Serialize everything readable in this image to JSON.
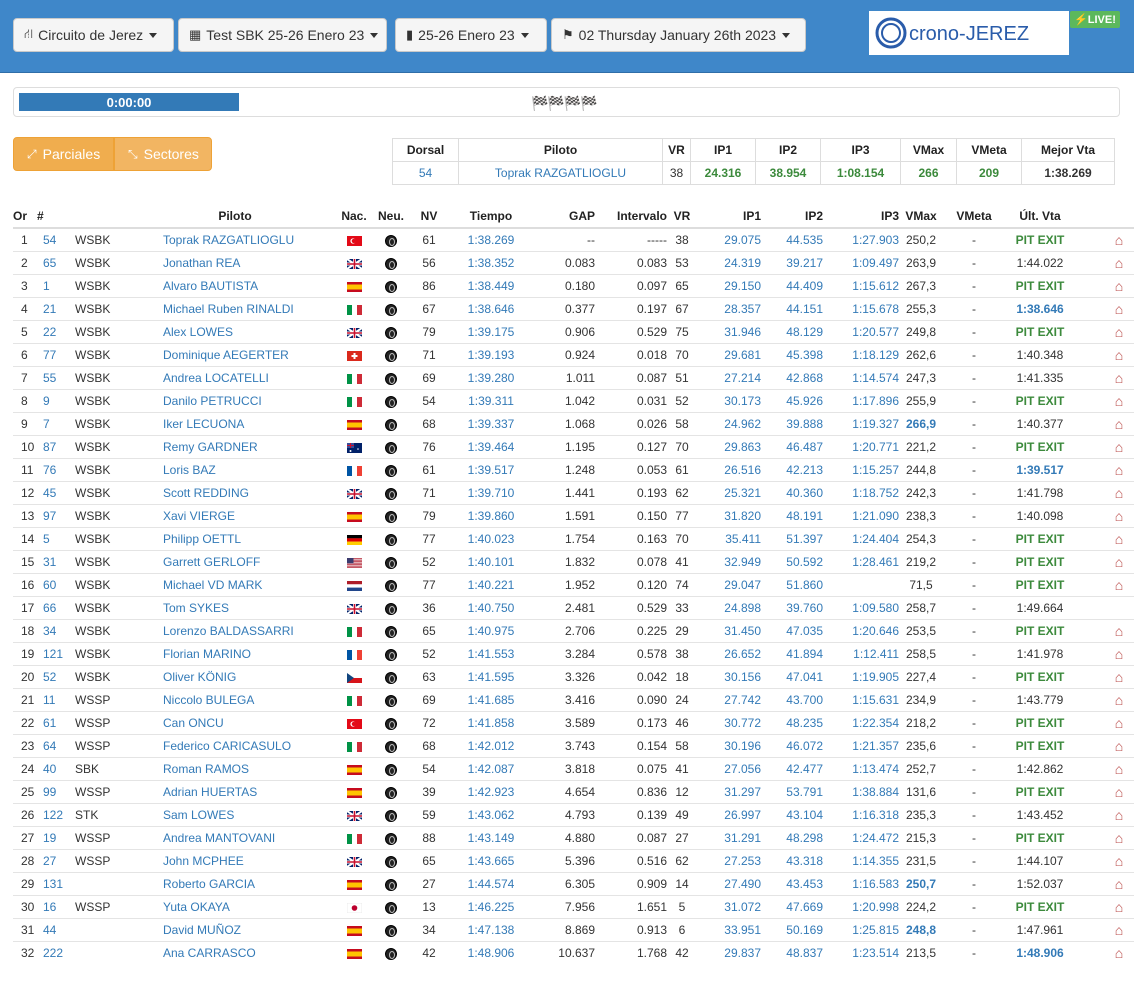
{
  "nav": {
    "circuit": "Circuito de Jerez",
    "event": "Test SBK 25-26 Enero 23",
    "dates": "25-26 Enero 23",
    "session": "02 Thursday January 26th 2023"
  },
  "logo_text": "crono-JEREZ",
  "live_label": "LIVE!",
  "timer": "0:00:00",
  "flags": "🏁🏁🏁🏁",
  "buttons": {
    "parciales": "Parciales",
    "sectores": "Sectores"
  },
  "best": {
    "headers": [
      "Dorsal",
      "Piloto",
      "VR",
      "IP1",
      "IP2",
      "IP3",
      "VMax",
      "VMeta",
      "Mejor Vta"
    ],
    "row": [
      "54",
      "Toprak RAZGATLIOGLU",
      "38",
      "24.316",
      "38.954",
      "1:08.154",
      "266",
      "209",
      "1:38.269"
    ]
  },
  "columns": [
    "Or",
    "#",
    "",
    "Piloto",
    "Nac.",
    "Neu.",
    "NV",
    "Tiempo",
    "GAP",
    "Intervalo",
    "VR",
    "IP1",
    "IP2",
    "IP3",
    "VMax",
    "VMeta",
    "Últ. Vta",
    ""
  ],
  "pit_exit_label": "PIT EXIT",
  "colors": {
    "header": "#3f87c9",
    "link": "#337ab7",
    "pit": "#3c8a3c",
    "accent": "#f0ad4e",
    "home": "#b94a48"
  },
  "rows": [
    {
      "or": "1",
      "num": "54",
      "cls": "WSBK",
      "name": "Toprak RAZGATLIOGLU",
      "nat": "tr",
      "nv": "61",
      "time": "1:38.269",
      "gap": "--",
      "int": "-----",
      "vr": "38",
      "ip1": "29.075",
      "ip2": "44.535",
      "ip3": "1:27.903",
      "vmax": "250,2",
      "vmaxb": false,
      "vmeta": "-",
      "last": "PIT EXIT",
      "lastType": "pit",
      "home": true
    },
    {
      "or": "2",
      "num": "65",
      "cls": "WSBK",
      "name": "Jonathan REA",
      "nat": "gb",
      "nv": "56",
      "time": "1:38.352",
      "gap": "0.083",
      "int": "0.083",
      "vr": "53",
      "ip1": "24.319",
      "ip2": "39.217",
      "ip3": "1:09.497",
      "vmax": "263,9",
      "vmaxb": false,
      "vmeta": "-",
      "last": "1:44.022",
      "lastType": "t",
      "home": true
    },
    {
      "or": "3",
      "num": "1",
      "cls": "WSBK",
      "name": "Alvaro BAUTISTA",
      "nat": "es",
      "nv": "86",
      "time": "1:38.449",
      "gap": "0.180",
      "int": "0.097",
      "vr": "65",
      "ip1": "29.150",
      "ip2": "44.409",
      "ip3": "1:15.612",
      "vmax": "267,3",
      "vmaxb": false,
      "vmeta": "-",
      "last": "PIT EXIT",
      "lastType": "pit",
      "home": true
    },
    {
      "or": "4",
      "num": "21",
      "cls": "WSBK",
      "name": "Michael Ruben RINALDI",
      "nat": "it",
      "nv": "67",
      "time": "1:38.646",
      "gap": "0.377",
      "int": "0.197",
      "vr": "67",
      "ip1": "28.357",
      "ip2": "44.151",
      "ip3": "1:15.678",
      "vmax": "255,3",
      "vmaxb": false,
      "vmeta": "-",
      "last": "1:38.646",
      "lastType": "best",
      "home": true
    },
    {
      "or": "5",
      "num": "22",
      "cls": "WSBK",
      "name": "Alex LOWES",
      "nat": "gb",
      "nv": "79",
      "time": "1:39.175",
      "gap": "0.906",
      "int": "0.529",
      "vr": "75",
      "ip1": "31.946",
      "ip2": "48.129",
      "ip3": "1:20.577",
      "vmax": "249,8",
      "vmaxb": false,
      "vmeta": "-",
      "last": "PIT EXIT",
      "lastType": "pit",
      "home": true
    },
    {
      "or": "6",
      "num": "77",
      "cls": "WSBK",
      "name": "Dominique AEGERTER",
      "nat": "ch",
      "nv": "71",
      "time": "1:39.193",
      "gap": "0.924",
      "int": "0.018",
      "vr": "70",
      "ip1": "29.681",
      "ip2": "45.398",
      "ip3": "1:18.129",
      "vmax": "262,6",
      "vmaxb": false,
      "vmeta": "-",
      "last": "1:40.348",
      "lastType": "t",
      "home": true
    },
    {
      "or": "7",
      "num": "55",
      "cls": "WSBK",
      "name": "Andrea LOCATELLI",
      "nat": "it",
      "nv": "69",
      "time": "1:39.280",
      "gap": "1.011",
      "int": "0.087",
      "vr": "51",
      "ip1": "27.214",
      "ip2": "42.868",
      "ip3": "1:14.574",
      "vmax": "247,3",
      "vmaxb": false,
      "vmeta": "-",
      "last": "1:41.335",
      "lastType": "t",
      "home": true
    },
    {
      "or": "8",
      "num": "9",
      "cls": "WSBK",
      "name": "Danilo PETRUCCI",
      "nat": "it",
      "nv": "54",
      "time": "1:39.311",
      "gap": "1.042",
      "int": "0.031",
      "vr": "52",
      "ip1": "30.173",
      "ip2": "45.926",
      "ip3": "1:17.896",
      "vmax": "255,9",
      "vmaxb": false,
      "vmeta": "-",
      "last": "PIT EXIT",
      "lastType": "pit",
      "home": true
    },
    {
      "or": "9",
      "num": "7",
      "cls": "WSBK",
      "name": "Iker LECUONA",
      "nat": "es",
      "nv": "68",
      "time": "1:39.337",
      "gap": "1.068",
      "int": "0.026",
      "vr": "58",
      "ip1": "24.962",
      "ip2": "39.888",
      "ip3": "1:19.327",
      "vmax": "266,9",
      "vmaxb": true,
      "vmeta": "-",
      "last": "1:40.377",
      "lastType": "t",
      "home": true
    },
    {
      "or": "10",
      "num": "87",
      "cls": "WSBK",
      "name": "Remy GARDNER",
      "nat": "au",
      "nv": "76",
      "time": "1:39.464",
      "gap": "1.195",
      "int": "0.127",
      "vr": "70",
      "ip1": "29.863",
      "ip2": "46.487",
      "ip3": "1:20.771",
      "vmax": "221,2",
      "vmaxb": false,
      "vmeta": "-",
      "last": "PIT EXIT",
      "lastType": "pit",
      "home": true
    },
    {
      "or": "11",
      "num": "76",
      "cls": "WSBK",
      "name": "Loris BAZ",
      "nat": "fr",
      "nv": "61",
      "time": "1:39.517",
      "gap": "1.248",
      "int": "0.053",
      "vr": "61",
      "ip1": "26.516",
      "ip2": "42.213",
      "ip3": "1:15.257",
      "vmax": "244,8",
      "vmaxb": false,
      "vmeta": "-",
      "last": "1:39.517",
      "lastType": "best",
      "home": true
    },
    {
      "or": "12",
      "num": "45",
      "cls": "WSBK",
      "name": "Scott REDDING",
      "nat": "gb",
      "nv": "71",
      "time": "1:39.710",
      "gap": "1.441",
      "int": "0.193",
      "vr": "62",
      "ip1": "25.321",
      "ip2": "40.360",
      "ip3": "1:18.752",
      "vmax": "242,3",
      "vmaxb": false,
      "vmeta": "-",
      "last": "1:41.798",
      "lastType": "t",
      "home": true
    },
    {
      "or": "13",
      "num": "97",
      "cls": "WSBK",
      "name": "Xavi VIERGE",
      "nat": "es",
      "nv": "79",
      "time": "1:39.860",
      "gap": "1.591",
      "int": "0.150",
      "vr": "77",
      "ip1": "31.820",
      "ip2": "48.191",
      "ip3": "1:21.090",
      "vmax": "238,3",
      "vmaxb": false,
      "vmeta": "-",
      "last": "1:40.098",
      "lastType": "t",
      "home": true
    },
    {
      "or": "14",
      "num": "5",
      "cls": "WSBK",
      "name": "Philipp OETTL",
      "nat": "de",
      "nv": "77",
      "time": "1:40.023",
      "gap": "1.754",
      "int": "0.163",
      "vr": "70",
      "ip1": "35.411",
      "ip2": "51.397",
      "ip3": "1:24.404",
      "vmax": "254,3",
      "vmaxb": false,
      "vmeta": "-",
      "last": "PIT EXIT",
      "lastType": "pit",
      "home": true
    },
    {
      "or": "15",
      "num": "31",
      "cls": "WSBK",
      "name": "Garrett GERLOFF",
      "nat": "us",
      "nv": "52",
      "time": "1:40.101",
      "gap": "1.832",
      "int": "0.078",
      "vr": "41",
      "ip1": "32.949",
      "ip2": "50.592",
      "ip3": "1:28.461",
      "vmax": "219,2",
      "vmaxb": false,
      "vmeta": "-",
      "last": "PIT EXIT",
      "lastType": "pit",
      "home": true
    },
    {
      "or": "16",
      "num": "60",
      "cls": "WSBK",
      "name": "Michael VD MARK",
      "nat": "nl",
      "nv": "77",
      "time": "1:40.221",
      "gap": "1.952",
      "int": "0.120",
      "vr": "74",
      "ip1": "29.047",
      "ip2": "51.860",
      "ip3": "",
      "vmax": "71,5",
      "vmaxb": false,
      "vmeta": "-",
      "last": "PIT EXIT",
      "lastType": "pit",
      "home": true
    },
    {
      "or": "17",
      "num": "66",
      "cls": "WSBK",
      "name": "Tom SYKES",
      "nat": "gb",
      "nv": "36",
      "time": "1:40.750",
      "gap": "2.481",
      "int": "0.529",
      "vr": "33",
      "ip1": "24.898",
      "ip2": "39.760",
      "ip3": "1:09.580",
      "vmax": "258,7",
      "vmaxb": false,
      "vmeta": "-",
      "last": "1:49.664",
      "lastType": "t",
      "home": false
    },
    {
      "or": "18",
      "num": "34",
      "cls": "WSBK",
      "name": "Lorenzo BALDASSARRI",
      "nat": "it",
      "nv": "65",
      "time": "1:40.975",
      "gap": "2.706",
      "int": "0.225",
      "vr": "29",
      "ip1": "31.450",
      "ip2": "47.035",
      "ip3": "1:20.646",
      "vmax": "253,5",
      "vmaxb": false,
      "vmeta": "-",
      "last": "PIT EXIT",
      "lastType": "pit",
      "home": true
    },
    {
      "or": "19",
      "num": "121",
      "cls": "WSBK",
      "name": "Florian MARINO",
      "nat": "fr",
      "nv": "52",
      "time": "1:41.553",
      "gap": "3.284",
      "int": "0.578",
      "vr": "38",
      "ip1": "26.652",
      "ip2": "41.894",
      "ip3": "1:12.411",
      "vmax": "258,5",
      "vmaxb": false,
      "vmeta": "-",
      "last": "1:41.978",
      "lastType": "t",
      "home": true
    },
    {
      "or": "20",
      "num": "52",
      "cls": "WSBK",
      "name": "Oliver KÖNIG",
      "nat": "cz",
      "nv": "63",
      "time": "1:41.595",
      "gap": "3.326",
      "int": "0.042",
      "vr": "18",
      "ip1": "30.156",
      "ip2": "47.041",
      "ip3": "1:19.905",
      "vmax": "227,4",
      "vmaxb": false,
      "vmeta": "-",
      "last": "PIT EXIT",
      "lastType": "pit",
      "home": true
    },
    {
      "or": "21",
      "num": "11",
      "cls": "WSSP",
      "name": "Niccolo BULEGA",
      "nat": "it",
      "nv": "69",
      "time": "1:41.685",
      "gap": "3.416",
      "int": "0.090",
      "vr": "24",
      "ip1": "27.742",
      "ip2": "43.700",
      "ip3": "1:15.631",
      "vmax": "234,9",
      "vmaxb": false,
      "vmeta": "-",
      "last": "1:43.779",
      "lastType": "t",
      "home": true
    },
    {
      "or": "22",
      "num": "61",
      "cls": "WSSP",
      "name": "Can ONCU",
      "nat": "tr",
      "nv": "72",
      "time": "1:41.858",
      "gap": "3.589",
      "int": "0.173",
      "vr": "46",
      "ip1": "30.772",
      "ip2": "48.235",
      "ip3": "1:22.354",
      "vmax": "218,2",
      "vmaxb": false,
      "vmeta": "-",
      "last": "PIT EXIT",
      "lastType": "pit",
      "home": true
    },
    {
      "or": "23",
      "num": "64",
      "cls": "WSSP",
      "name": "Federico CARICASULO",
      "nat": "it",
      "nv": "68",
      "time": "1:42.012",
      "gap": "3.743",
      "int": "0.154",
      "vr": "58",
      "ip1": "30.196",
      "ip2": "46.072",
      "ip3": "1:21.357",
      "vmax": "235,6",
      "vmaxb": false,
      "vmeta": "-",
      "last": "PIT EXIT",
      "lastType": "pit",
      "home": true
    },
    {
      "or": "24",
      "num": "40",
      "cls": "SBK",
      "name": "Roman RAMOS",
      "nat": "es",
      "nv": "54",
      "time": "1:42.087",
      "gap": "3.818",
      "int": "0.075",
      "vr": "41",
      "ip1": "27.056",
      "ip2": "42.477",
      "ip3": "1:13.474",
      "vmax": "252,7",
      "vmaxb": false,
      "vmeta": "-",
      "last": "1:42.862",
      "lastType": "t",
      "home": true
    },
    {
      "or": "25",
      "num": "99",
      "cls": "WSSP",
      "name": "Adrian HUERTAS",
      "nat": "es",
      "nv": "39",
      "time": "1:42.923",
      "gap": "4.654",
      "int": "0.836",
      "vr": "12",
      "ip1": "31.297",
      "ip2": "53.791",
      "ip3": "1:38.884",
      "vmax": "131,6",
      "vmaxb": false,
      "vmeta": "-",
      "last": "PIT EXIT",
      "lastType": "pit",
      "home": true
    },
    {
      "or": "26",
      "num": "122",
      "cls": "STK",
      "name": "Sam LOWES",
      "nat": "gb",
      "nv": "59",
      "time": "1:43.062",
      "gap": "4.793",
      "int": "0.139",
      "vr": "49",
      "ip1": "26.997",
      "ip2": "43.104",
      "ip3": "1:16.318",
      "vmax": "235,3",
      "vmaxb": false,
      "vmeta": "-",
      "last": "1:43.452",
      "lastType": "t",
      "home": true
    },
    {
      "or": "27",
      "num": "19",
      "cls": "WSSP",
      "name": "Andrea MANTOVANI",
      "nat": "it",
      "nv": "88",
      "time": "1:43.149",
      "gap": "4.880",
      "int": "0.087",
      "vr": "27",
      "ip1": "31.291",
      "ip2": "48.298",
      "ip3": "1:24.472",
      "vmax": "215,3",
      "vmaxb": false,
      "vmeta": "-",
      "last": "PIT EXIT",
      "lastType": "pit",
      "home": true
    },
    {
      "or": "28",
      "num": "27",
      "cls": "WSSP",
      "name": "John MCPHEE",
      "nat": "gb",
      "nv": "65",
      "time": "1:43.665",
      "gap": "5.396",
      "int": "0.516",
      "vr": "62",
      "ip1": "27.253",
      "ip2": "43.318",
      "ip3": "1:14.355",
      "vmax": "231,5",
      "vmaxb": false,
      "vmeta": "-",
      "last": "1:44.107",
      "lastType": "t",
      "home": true
    },
    {
      "or": "29",
      "num": "131",
      "cls": "",
      "name": "Roberto GARCIA",
      "nat": "es",
      "nv": "27",
      "time": "1:44.574",
      "gap": "6.305",
      "int": "0.909",
      "vr": "14",
      "ip1": "27.490",
      "ip2": "43.453",
      "ip3": "1:16.583",
      "vmax": "250,7",
      "vmaxb": true,
      "vmeta": "-",
      "last": "1:52.037",
      "lastType": "t",
      "home": true
    },
    {
      "or": "30",
      "num": "16",
      "cls": "WSSP",
      "name": "Yuta OKAYA",
      "nat": "jp",
      "nv": "13",
      "time": "1:46.225",
      "gap": "7.956",
      "int": "1.651",
      "vr": "5",
      "ip1": "31.072",
      "ip2": "47.669",
      "ip3": "1:20.998",
      "vmax": "224,2",
      "vmaxb": false,
      "vmeta": "-",
      "last": "PIT EXIT",
      "lastType": "pit",
      "home": true
    },
    {
      "or": "31",
      "num": "44",
      "cls": "",
      "name": "David MUÑOZ",
      "nat": "es",
      "nv": "34",
      "time": "1:47.138",
      "gap": "8.869",
      "int": "0.913",
      "vr": "6",
      "ip1": "33.951",
      "ip2": "50.169",
      "ip3": "1:25.815",
      "vmax": "248,8",
      "vmaxb": true,
      "vmeta": "-",
      "last": "1:47.961",
      "lastType": "t",
      "home": true
    },
    {
      "or": "32",
      "num": "222",
      "cls": "",
      "name": "Ana CARRASCO",
      "nat": "es",
      "nv": "42",
      "time": "1:48.906",
      "gap": "10.637",
      "int": "1.768",
      "vr": "42",
      "ip1": "29.837",
      "ip2": "48.837",
      "ip3": "1:23.514",
      "vmax": "213,5",
      "vmaxb": false,
      "vmeta": "-",
      "last": "1:48.906",
      "lastType": "best",
      "home": true
    }
  ]
}
